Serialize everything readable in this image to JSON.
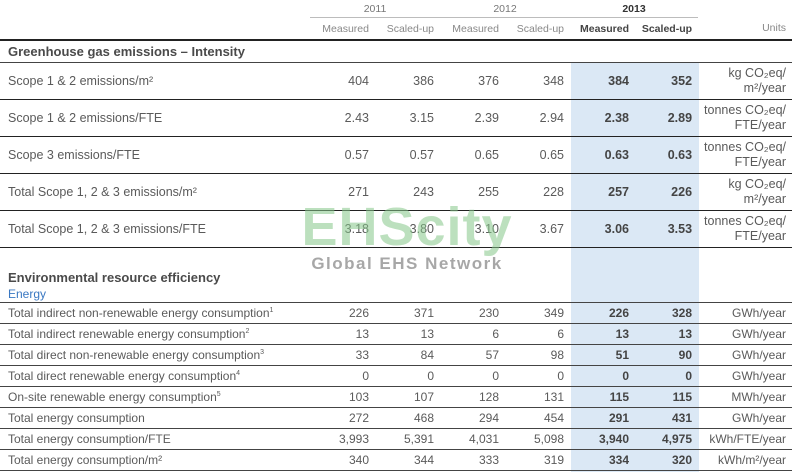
{
  "header": {
    "years": [
      "2011",
      "2012",
      "2013"
    ],
    "sub": [
      "Measured",
      "Scaled-up",
      "Measured",
      "Scaled-up",
      "Measured",
      "Scaled-up"
    ],
    "units_label": "Units"
  },
  "section1": {
    "title": "Greenhouse gas emissions – Intensity",
    "rows": [
      {
        "label": "Scope 1 & 2 emissions/m²",
        "v": [
          "404",
          "386",
          "376",
          "348",
          "384",
          "352"
        ],
        "unit1": "kg CO₂eq/",
        "unit2": "m²/year"
      },
      {
        "label": "Scope 1 & 2 emissions/FTE",
        "v": [
          "2.43",
          "3.15",
          "2.39",
          "2.94",
          "2.38",
          "2.89"
        ],
        "unit1": "tonnes CO₂eq/",
        "unit2": "FTE/year"
      },
      {
        "label": "Scope 3 emissions/FTE",
        "v": [
          "0.57",
          "0.57",
          "0.65",
          "0.65",
          "0.63",
          "0.63"
        ],
        "unit1": "tonnes CO₂eq/",
        "unit2": "FTE/year"
      },
      {
        "label": "Total Scope 1, 2 & 3 emissions/m²",
        "v": [
          "271",
          "243",
          "255",
          "228",
          "257",
          "226"
        ],
        "unit1": "kg CO₂eq/",
        "unit2": "m²/year"
      },
      {
        "label": "Total Scope 1, 2 & 3 emissions/FTE",
        "v": [
          "3.18",
          "3.80",
          "3.10",
          "3.67",
          "3.06",
          "3.53"
        ],
        "unit1": "tonnes CO₂eq/",
        "unit2": "FTE/year"
      }
    ]
  },
  "section2": {
    "title": "Environmental resource efficiency",
    "subtitle": "Energy",
    "rows": [
      {
        "label": "Total indirect non-renewable energy consumption",
        "sup": "1",
        "v": [
          "226",
          "371",
          "230",
          "349",
          "226",
          "328"
        ],
        "unit": "GWh/year"
      },
      {
        "label": "Total indirect renewable energy consumption",
        "sup": "2",
        "v": [
          "13",
          "13",
          "6",
          "6",
          "13",
          "13"
        ],
        "unit": "GWh/year"
      },
      {
        "label": "Total direct non-renewable energy consumption",
        "sup": "3",
        "v": [
          "33",
          "84",
          "57",
          "98",
          "51",
          "90"
        ],
        "unit": "GWh/year"
      },
      {
        "label": "Total direct renewable energy consumption",
        "sup": "4",
        "v": [
          "0",
          "0",
          "0",
          "0",
          "0",
          "0"
        ],
        "unit": "GWh/year"
      },
      {
        "label": "On-site renewable energy consumption",
        "sup": "5",
        "v": [
          "103",
          "107",
          "128",
          "131",
          "115",
          "115"
        ],
        "unit": "MWh/year"
      },
      {
        "label": "Total energy consumption",
        "sup": "",
        "v": [
          "272",
          "468",
          "294",
          "454",
          "291",
          "431"
        ],
        "unit": "GWh/year"
      },
      {
        "label": "Total energy consumption/FTE",
        "sup": "",
        "v": [
          "3,993",
          "5,391",
          "4,031",
          "5,098",
          "3,940",
          "4,975"
        ],
        "unit": "kWh/FTE/year"
      },
      {
        "label": "Total energy consumption/m²",
        "sup": "",
        "v": [
          "340",
          "344",
          "333",
          "319",
          "334",
          "320"
        ],
        "unit": "kWh/m²/year"
      }
    ]
  },
  "watermark": {
    "main": "EHScity",
    "sub": "Global EHS Network"
  }
}
